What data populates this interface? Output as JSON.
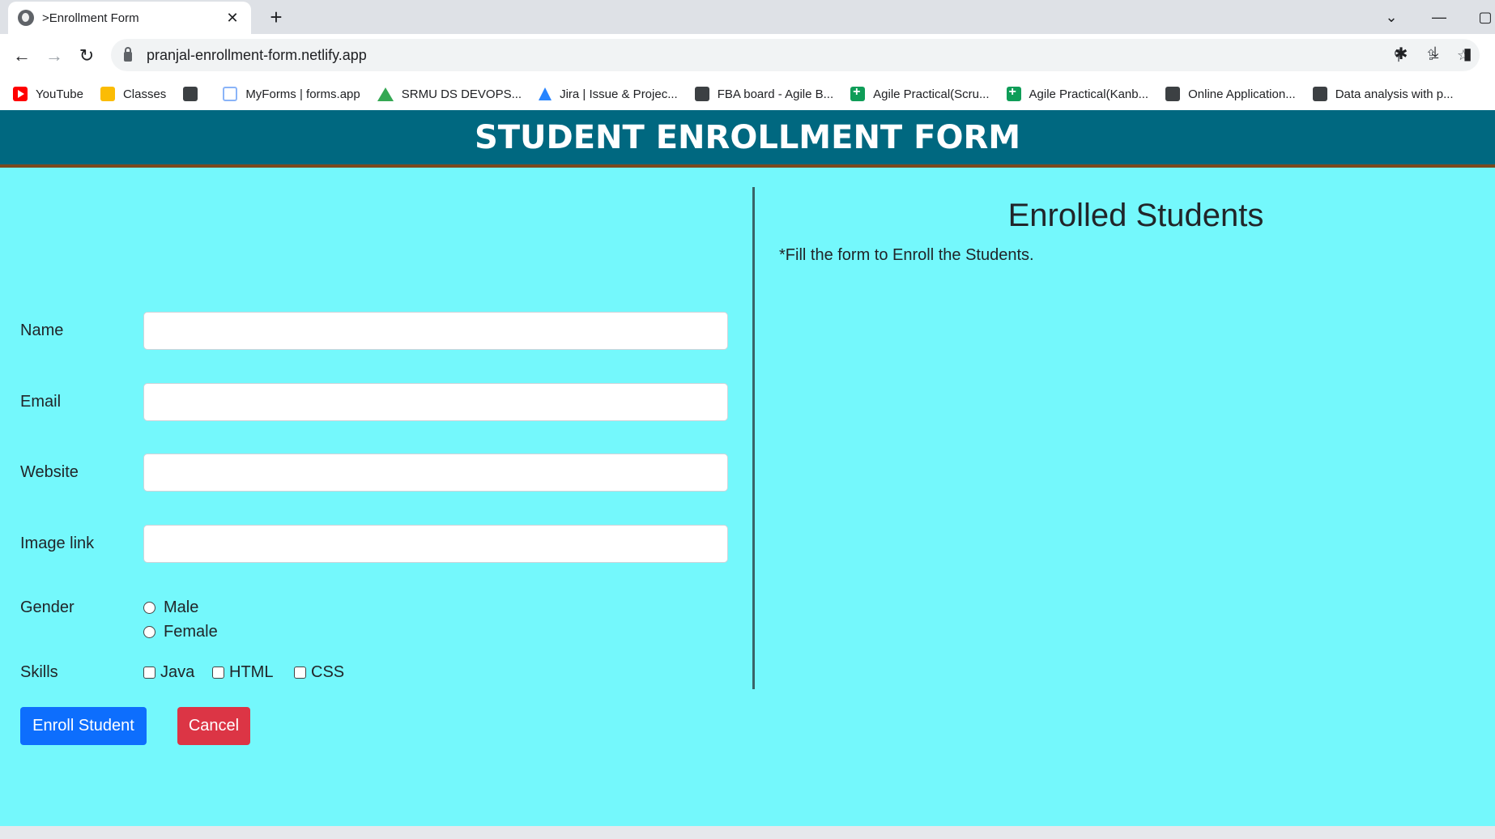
{
  "browser": {
    "tab_title": ">Enrollment Form",
    "tab_close": "✕",
    "new_tab": "+",
    "url": "pranjal-enrollment-form.netlify.app",
    "controls": {
      "chevron": "⌄",
      "minimize": "—",
      "restore": "▢"
    },
    "bookmarks": [
      {
        "label": "YouTube",
        "icon": "youtube-icon"
      },
      {
        "label": "Classes",
        "icon": "classes-icon"
      },
      {
        "label": "",
        "icon": "globe-icon"
      },
      {
        "label": "MyForms | forms.app",
        "icon": "forms-icon"
      },
      {
        "label": "SRMU DS DEVOPS...",
        "icon": "drive-icon"
      },
      {
        "label": "Jira | Issue & Projec...",
        "icon": "jira-icon"
      },
      {
        "label": "FBA board - Agile B...",
        "icon": "globe-icon"
      },
      {
        "label": "Agile Practical(Scru...",
        "icon": "sheets-icon"
      },
      {
        "label": "Agile Practical(Kanb...",
        "icon": "sheets-icon"
      },
      {
        "label": "Online Application...",
        "icon": "globe-icon"
      },
      {
        "label": "Data analysis with p...",
        "icon": "globe-icon"
      }
    ]
  },
  "page": {
    "header_title": "STUDENT ENROLLMENT FORM",
    "form": {
      "name_label": "Name",
      "email_label": "Email",
      "website_label": "Website",
      "image_label": "Image link",
      "gender_label": "Gender",
      "gender_options": [
        "Male",
        "Female"
      ],
      "skills_label": "Skills",
      "skills_options": [
        "Java",
        "HTML",
        "CSS"
      ],
      "enroll_button": "Enroll Student",
      "cancel_button": "Cancel"
    },
    "enrolled": {
      "title": "Enrolled Students",
      "note": "*Fill the form to Enroll the Students."
    }
  },
  "colors": {
    "page_bg": "#74f8fc",
    "header_bg": "#006880",
    "enroll_btn": "#0d6efd",
    "cancel_btn": "#dc3545"
  }
}
